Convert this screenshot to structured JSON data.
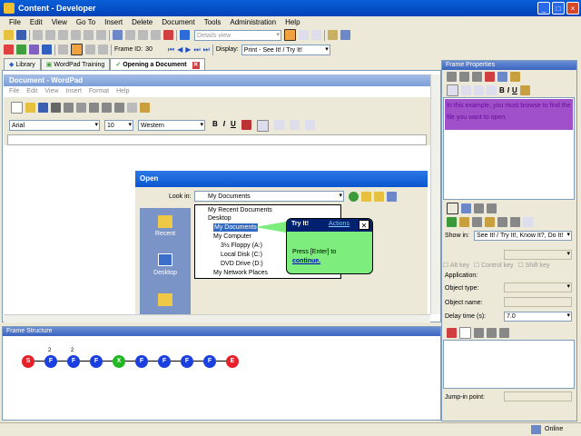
{
  "window": {
    "title": "Content - Developer",
    "min": "_",
    "max": "□",
    "close": "×"
  },
  "menu": [
    "File",
    "Edit",
    "View",
    "Go To",
    "Insert",
    "Delete",
    "Document",
    "Tools",
    "Administration",
    "Help"
  ],
  "toolbar": {
    "view_select": "Details view",
    "frame_id_label": "Frame ID:",
    "frame_id_value": "30",
    "display_label": "Display:",
    "display_value": "Print - See It! / Try It!"
  },
  "tabs": [
    {
      "label": "Library",
      "active": false
    },
    {
      "label": "WordPad Training",
      "active": false
    },
    {
      "label": "Opening a Document",
      "active": true
    }
  ],
  "wordpad": {
    "title": "Document - WordPad",
    "menu": [
      "File",
      "Edit",
      "View",
      "Insert",
      "Format",
      "Help"
    ],
    "font": "Arial",
    "size": "10",
    "script": "Western",
    "bold": "B",
    "italic": "I",
    "underline": "U"
  },
  "open_dialog": {
    "title": "Open",
    "look_in_label": "Look in:",
    "look_in_value": "My Documents",
    "places": [
      "Recent",
      "Desktop"
    ],
    "items": [
      "My Recent Documents",
      "Desktop",
      "My Documents",
      "My Computer",
      "3½ Floppy (A:)",
      "Local Disk (C:)",
      "DVD Drive (D:)",
      "My Network Places"
    ]
  },
  "callout": {
    "title": "Try It!",
    "actions": "Actions",
    "close": "✕",
    "text": "Press [Enter] to",
    "link": "continue."
  },
  "frame_structure": {
    "title": "Frame Structure",
    "nodes": [
      {
        "label": "S",
        "color": "#e8202a",
        "badge": ""
      },
      {
        "label": "F",
        "color": "#1c3fe0",
        "badge": "2"
      },
      {
        "label": "F",
        "color": "#1c3fe0",
        "badge": "2"
      },
      {
        "label": "F",
        "color": "#1c3fe0",
        "badge": ""
      },
      {
        "label": "X",
        "color": "#22b822",
        "badge": ""
      },
      {
        "label": "F",
        "color": "#1c3fe0",
        "badge": ""
      },
      {
        "label": "F",
        "color": "#1c3fe0",
        "badge": ""
      },
      {
        "label": "F",
        "color": "#1c3fe0",
        "badge": ""
      },
      {
        "label": "F",
        "color": "#1c3fe0",
        "badge": ""
      },
      {
        "label": "E",
        "color": "#e8202a",
        "badge": ""
      }
    ]
  },
  "frame_properties": {
    "title": "Frame Properties",
    "text_content": "In this example, you must browse to find the file you want to open.",
    "show_in_label": "Show in:",
    "show_in_value": "See It! / Try It!, Know It?, Do It!",
    "alt_key": "Alt key",
    "control_key": "Control key",
    "shift_key": "Shift key",
    "application_label": "Application:",
    "object_type_label": "Object type:",
    "object_name_label": "Object name:",
    "delay_label": "Delay time (s):",
    "delay_value": "7.0",
    "jump_label": "Jump-in point:"
  },
  "status": {
    "online": "Online"
  },
  "colors": {
    "title_blue": "#0a5fd8",
    "callout_green": "#7ded7d",
    "text_highlight": "#a050c8"
  }
}
